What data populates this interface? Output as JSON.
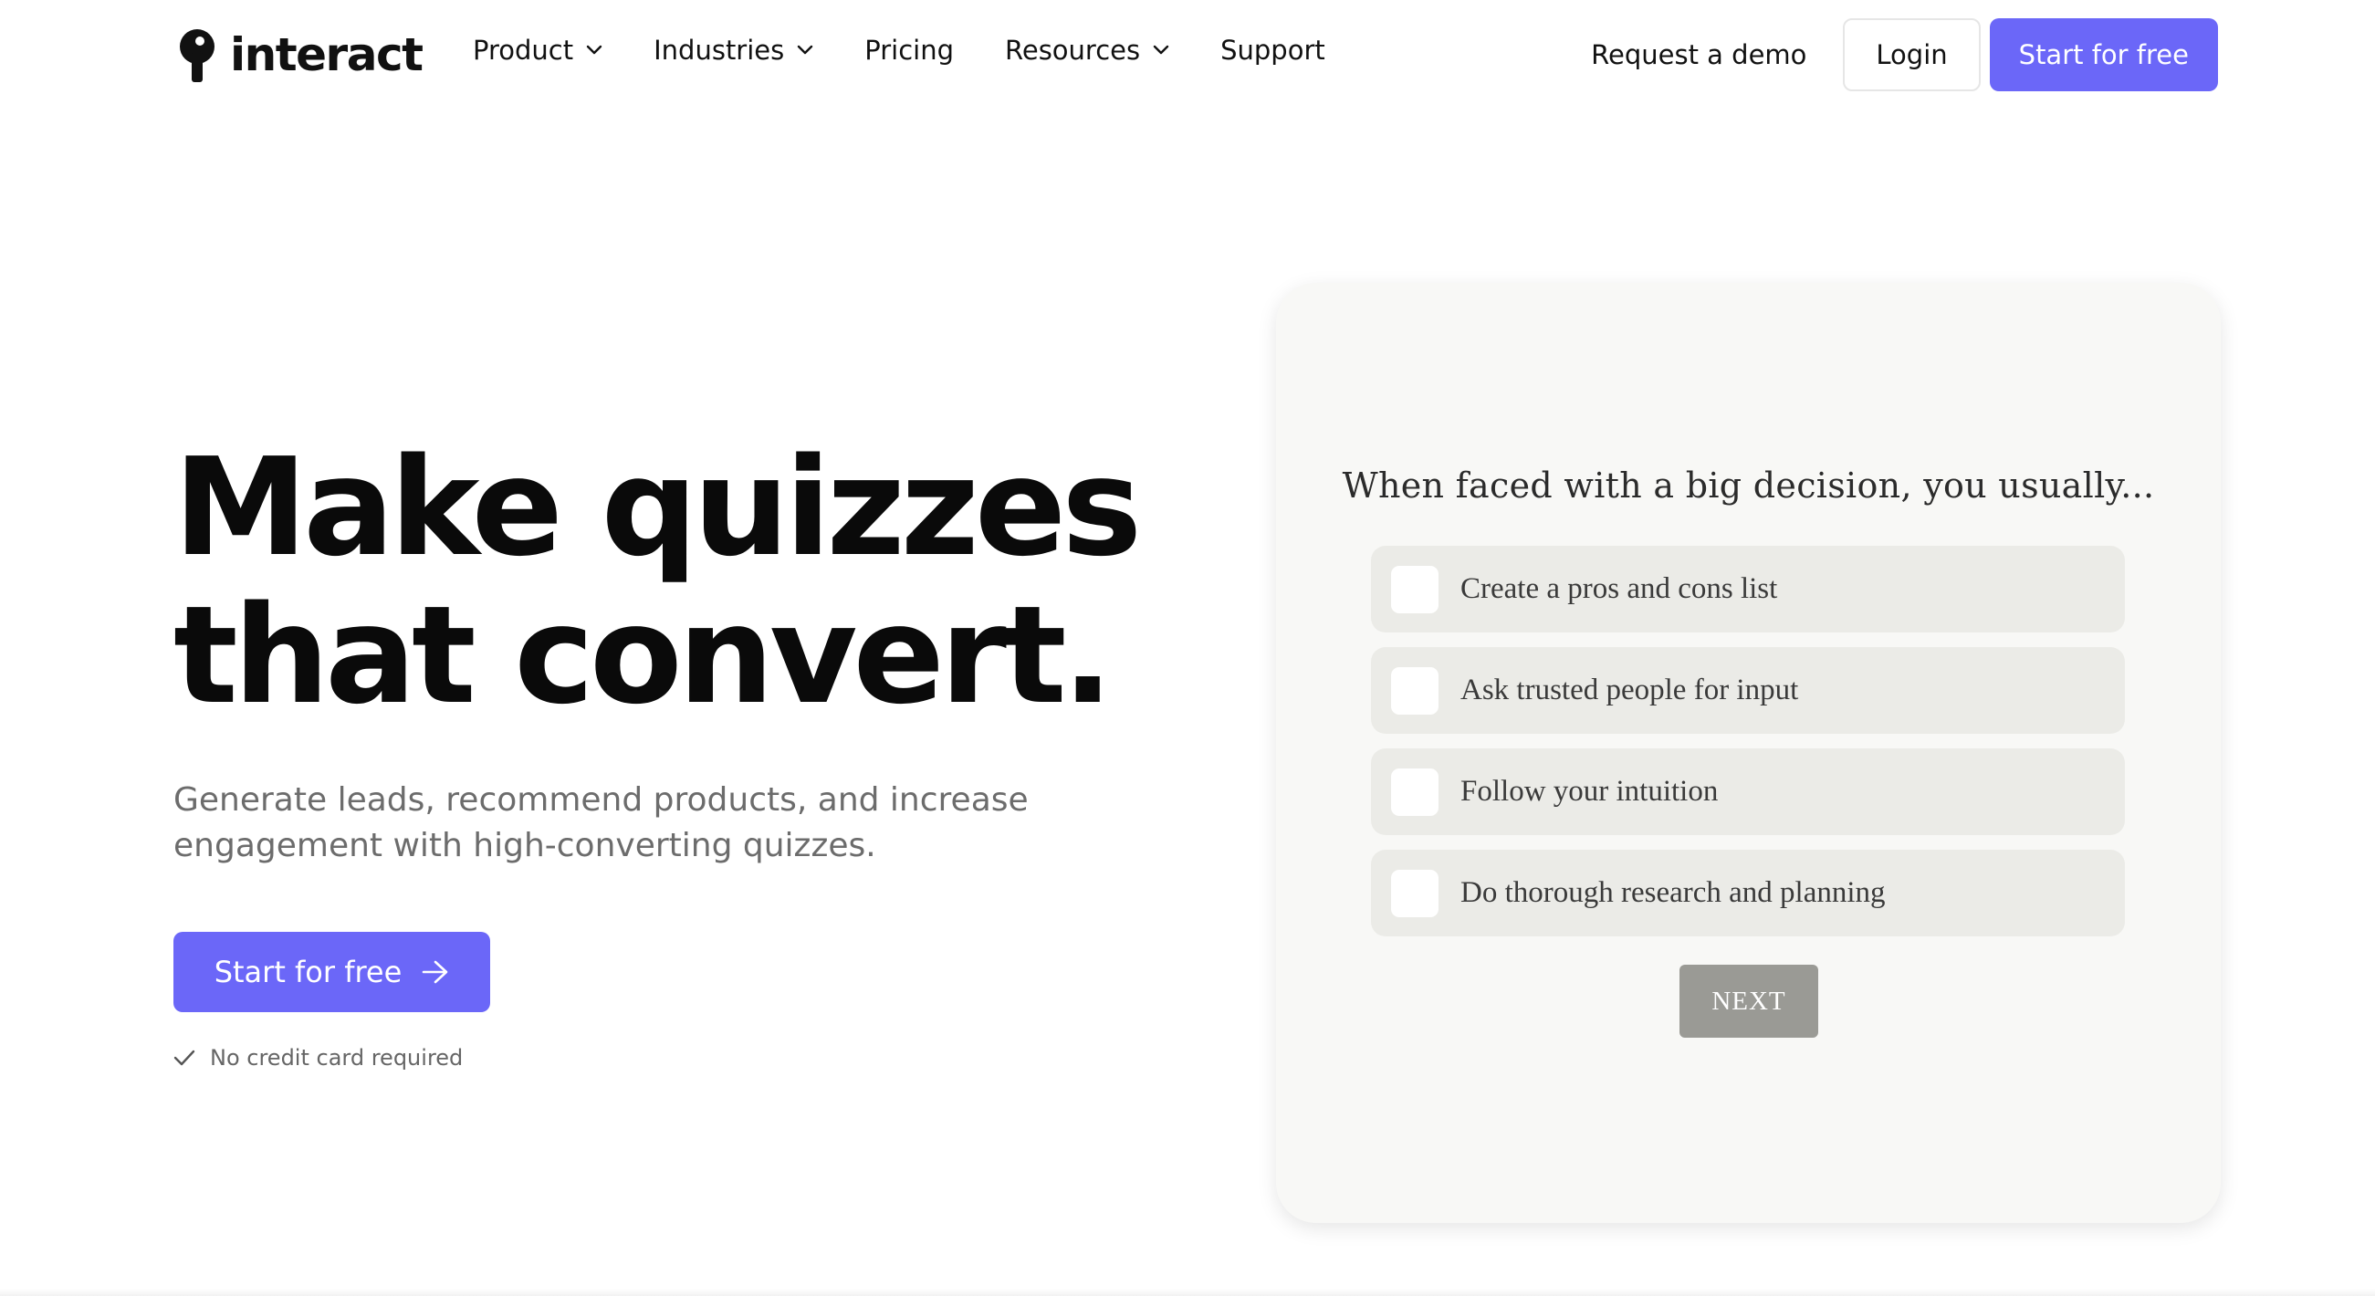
{
  "brand": {
    "name": "interact",
    "accent_color": "#6b67f8"
  },
  "nav": {
    "items": [
      {
        "label": "Product",
        "has_dropdown": true
      },
      {
        "label": "Industries",
        "has_dropdown": true
      },
      {
        "label": "Pricing",
        "has_dropdown": false
      },
      {
        "label": "Resources",
        "has_dropdown": true
      },
      {
        "label": "Support",
        "has_dropdown": false
      }
    ],
    "request_demo": "Request a demo",
    "login": "Login",
    "start_free": "Start for free"
  },
  "hero": {
    "headline_line1": "Make quizzes",
    "headline_line2": "that convert.",
    "subhead": "Generate leads, recommend products, and increase engagement with high-converting quizzes.",
    "cta_label": "Start for free",
    "note": "No credit card required"
  },
  "quiz": {
    "question": "When faced with a big decision, you usually...",
    "options": [
      "Create a pros and cons list",
      "Ask trusted people for input",
      "Follow your intuition",
      "Do thorough research and planning"
    ],
    "next_label": "NEXT",
    "card_bg": "#f8f8f6",
    "option_bg": "#ebebe7",
    "next_bg": "#9a9a95"
  },
  "icons": {
    "dropdown": "chevron-down-icon",
    "cta_arrow": "arrow-right-icon",
    "note_check": "check-icon"
  }
}
